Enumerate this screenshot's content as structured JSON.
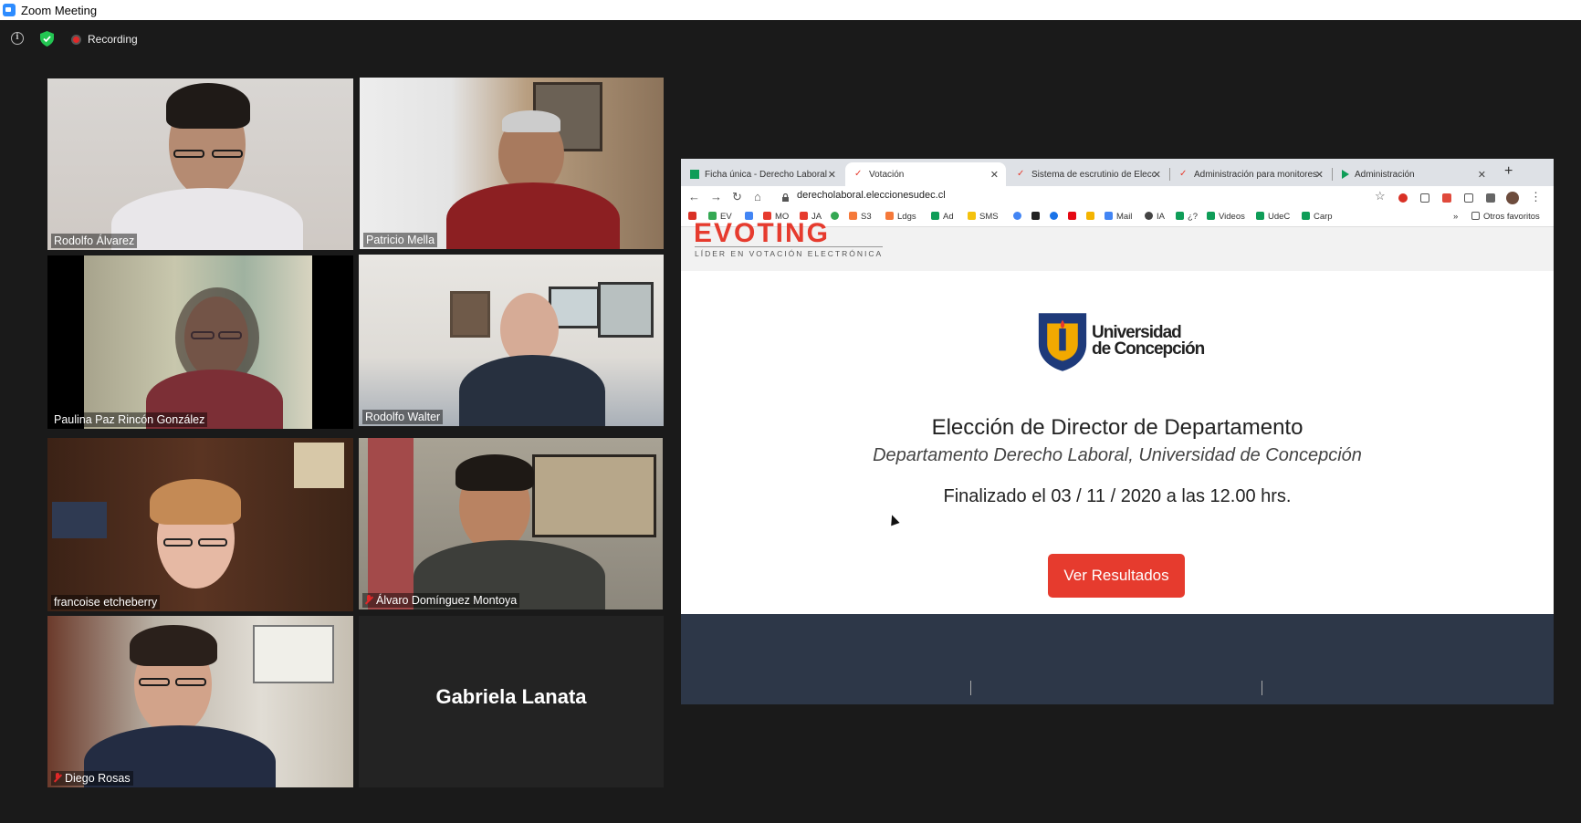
{
  "window": {
    "title": "Zoom Meeting"
  },
  "meeting_bar": {
    "recording_label": "Recording"
  },
  "participants": [
    {
      "name": "Rodolfo Álvarez",
      "muted": false
    },
    {
      "name": "Patricio Mella",
      "muted": false
    },
    {
      "name": "Paulina Paz Rincón González",
      "muted": false
    },
    {
      "name": "Rodolfo Walter",
      "muted": false
    },
    {
      "name": "francoise etcheberry",
      "muted": false
    },
    {
      "name": "Álvaro Domínguez Montoya",
      "muted": true
    },
    {
      "name": "Diego Rosas",
      "muted": true
    },
    {
      "name": "Gabriela Lanata",
      "muted": false,
      "video": false
    }
  ],
  "browser": {
    "tabs": [
      {
        "label": "Ficha única - Derecho Laboral"
      },
      {
        "label": "Votación"
      },
      {
        "label": "Sistema de escrutinio de Elecc"
      },
      {
        "label": "Administración para monitores"
      },
      {
        "label": "Administración"
      }
    ],
    "url": "derecholaboral.eleccionesudec.cl",
    "bookmarks": [
      "EV",
      "MO",
      "JA",
      "S3",
      "Ldgs",
      "Ad",
      "SMS",
      "Mail",
      "IA",
      "¿?",
      "Videos",
      "UdeC",
      "Carp"
    ],
    "other_bookmarks": "Otros favoritos",
    "more": "»"
  },
  "page": {
    "brand": "EVOTING",
    "tagline": "LÍDER EN VOTACIÓN ELECTRÓNICA",
    "university_line1": "Universidad",
    "university_line2": "de Concepción",
    "election_title": "Elección de Director de Departamento",
    "election_subtitle": "Departamento Derecho Laboral, Universidad de Concepción",
    "finished_text": "Finalizado el 03 / 11 / 2020 a las 12.00 hrs.",
    "results_button": "Ver Resultados"
  },
  "colors": {
    "accent": "#e63b2e",
    "footer": "#2d3748",
    "zoom_blue": "#2d8cff"
  }
}
